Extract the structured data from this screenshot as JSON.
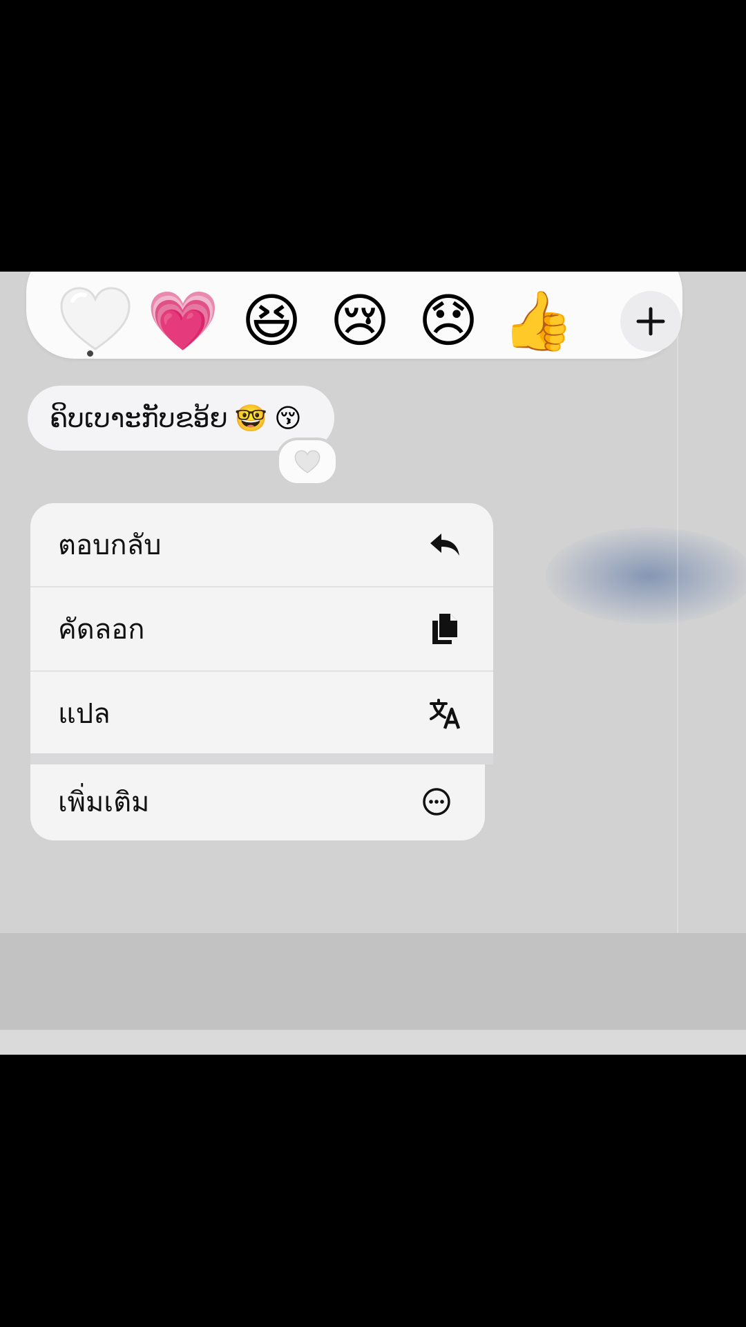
{
  "reactions": [
    {
      "name": "white-heart",
      "glyph": "🤍"
    },
    {
      "name": "growing-heart",
      "glyph": "💗"
    },
    {
      "name": "grinning-squinting-face",
      "glyph": "😆"
    },
    {
      "name": "crying-face",
      "glyph": "😢"
    },
    {
      "name": "disappointed-face",
      "glyph": "😞"
    },
    {
      "name": "thumbs-up",
      "glyph": "👍"
    }
  ],
  "add_reaction_icon": "plus-icon",
  "message": {
    "text": "ຄິບເບາະກັບຂອ້ຍ",
    "emoji_1": "🤓",
    "emoji_2": "😚",
    "reaction_badge": "white-heart"
  },
  "menu": {
    "reply_label": "ตอบกลับ",
    "copy_label": "คัดลอก",
    "translate_label": "แปล",
    "more_label": "เพิ่มเติม"
  },
  "colors": {
    "backdrop": "#d2d2d2",
    "panel": "#f4f4f5",
    "text": "#111111"
  }
}
